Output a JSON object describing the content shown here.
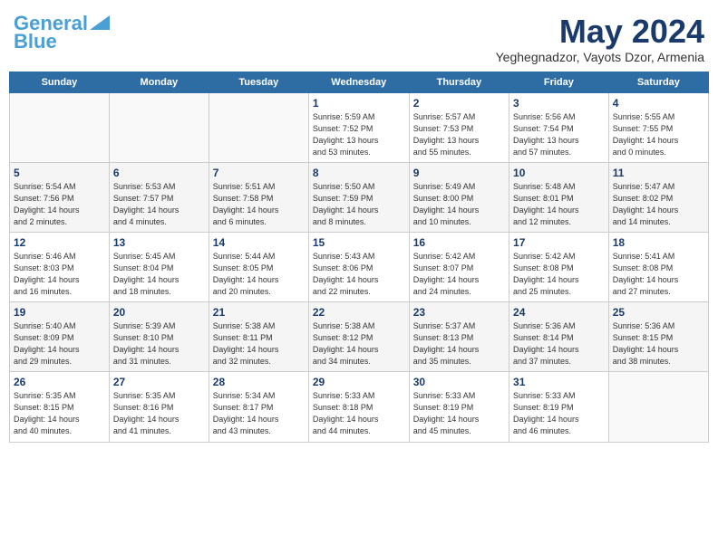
{
  "header": {
    "logo_line1": "General",
    "logo_line2": "Blue",
    "month": "May 2024",
    "location": "Yeghegnadzor, Vayots Dzor, Armenia"
  },
  "days_of_week": [
    "Sunday",
    "Monday",
    "Tuesday",
    "Wednesday",
    "Thursday",
    "Friday",
    "Saturday"
  ],
  "weeks": [
    [
      {
        "day": "",
        "info": ""
      },
      {
        "day": "",
        "info": ""
      },
      {
        "day": "",
        "info": ""
      },
      {
        "day": "1",
        "info": "Sunrise: 5:59 AM\nSunset: 7:52 PM\nDaylight: 13 hours\nand 53 minutes."
      },
      {
        "day": "2",
        "info": "Sunrise: 5:57 AM\nSunset: 7:53 PM\nDaylight: 13 hours\nand 55 minutes."
      },
      {
        "day": "3",
        "info": "Sunrise: 5:56 AM\nSunset: 7:54 PM\nDaylight: 13 hours\nand 57 minutes."
      },
      {
        "day": "4",
        "info": "Sunrise: 5:55 AM\nSunset: 7:55 PM\nDaylight: 14 hours\nand 0 minutes."
      }
    ],
    [
      {
        "day": "5",
        "info": "Sunrise: 5:54 AM\nSunset: 7:56 PM\nDaylight: 14 hours\nand 2 minutes."
      },
      {
        "day": "6",
        "info": "Sunrise: 5:53 AM\nSunset: 7:57 PM\nDaylight: 14 hours\nand 4 minutes."
      },
      {
        "day": "7",
        "info": "Sunrise: 5:51 AM\nSunset: 7:58 PM\nDaylight: 14 hours\nand 6 minutes."
      },
      {
        "day": "8",
        "info": "Sunrise: 5:50 AM\nSunset: 7:59 PM\nDaylight: 14 hours\nand 8 minutes."
      },
      {
        "day": "9",
        "info": "Sunrise: 5:49 AM\nSunset: 8:00 PM\nDaylight: 14 hours\nand 10 minutes."
      },
      {
        "day": "10",
        "info": "Sunrise: 5:48 AM\nSunset: 8:01 PM\nDaylight: 14 hours\nand 12 minutes."
      },
      {
        "day": "11",
        "info": "Sunrise: 5:47 AM\nSunset: 8:02 PM\nDaylight: 14 hours\nand 14 minutes."
      }
    ],
    [
      {
        "day": "12",
        "info": "Sunrise: 5:46 AM\nSunset: 8:03 PM\nDaylight: 14 hours\nand 16 minutes."
      },
      {
        "day": "13",
        "info": "Sunrise: 5:45 AM\nSunset: 8:04 PM\nDaylight: 14 hours\nand 18 minutes."
      },
      {
        "day": "14",
        "info": "Sunrise: 5:44 AM\nSunset: 8:05 PM\nDaylight: 14 hours\nand 20 minutes."
      },
      {
        "day": "15",
        "info": "Sunrise: 5:43 AM\nSunset: 8:06 PM\nDaylight: 14 hours\nand 22 minutes."
      },
      {
        "day": "16",
        "info": "Sunrise: 5:42 AM\nSunset: 8:07 PM\nDaylight: 14 hours\nand 24 minutes."
      },
      {
        "day": "17",
        "info": "Sunrise: 5:42 AM\nSunset: 8:08 PM\nDaylight: 14 hours\nand 25 minutes."
      },
      {
        "day": "18",
        "info": "Sunrise: 5:41 AM\nSunset: 8:08 PM\nDaylight: 14 hours\nand 27 minutes."
      }
    ],
    [
      {
        "day": "19",
        "info": "Sunrise: 5:40 AM\nSunset: 8:09 PM\nDaylight: 14 hours\nand 29 minutes."
      },
      {
        "day": "20",
        "info": "Sunrise: 5:39 AM\nSunset: 8:10 PM\nDaylight: 14 hours\nand 31 minutes."
      },
      {
        "day": "21",
        "info": "Sunrise: 5:38 AM\nSunset: 8:11 PM\nDaylight: 14 hours\nand 32 minutes."
      },
      {
        "day": "22",
        "info": "Sunrise: 5:38 AM\nSunset: 8:12 PM\nDaylight: 14 hours\nand 34 minutes."
      },
      {
        "day": "23",
        "info": "Sunrise: 5:37 AM\nSunset: 8:13 PM\nDaylight: 14 hours\nand 35 minutes."
      },
      {
        "day": "24",
        "info": "Sunrise: 5:36 AM\nSunset: 8:14 PM\nDaylight: 14 hours\nand 37 minutes."
      },
      {
        "day": "25",
        "info": "Sunrise: 5:36 AM\nSunset: 8:15 PM\nDaylight: 14 hours\nand 38 minutes."
      }
    ],
    [
      {
        "day": "26",
        "info": "Sunrise: 5:35 AM\nSunset: 8:15 PM\nDaylight: 14 hours\nand 40 minutes."
      },
      {
        "day": "27",
        "info": "Sunrise: 5:35 AM\nSunset: 8:16 PM\nDaylight: 14 hours\nand 41 minutes."
      },
      {
        "day": "28",
        "info": "Sunrise: 5:34 AM\nSunset: 8:17 PM\nDaylight: 14 hours\nand 43 minutes."
      },
      {
        "day": "29",
        "info": "Sunrise: 5:33 AM\nSunset: 8:18 PM\nDaylight: 14 hours\nand 44 minutes."
      },
      {
        "day": "30",
        "info": "Sunrise: 5:33 AM\nSunset: 8:19 PM\nDaylight: 14 hours\nand 45 minutes."
      },
      {
        "day": "31",
        "info": "Sunrise: 5:33 AM\nSunset: 8:19 PM\nDaylight: 14 hours\nand 46 minutes."
      },
      {
        "day": "",
        "info": ""
      }
    ]
  ]
}
